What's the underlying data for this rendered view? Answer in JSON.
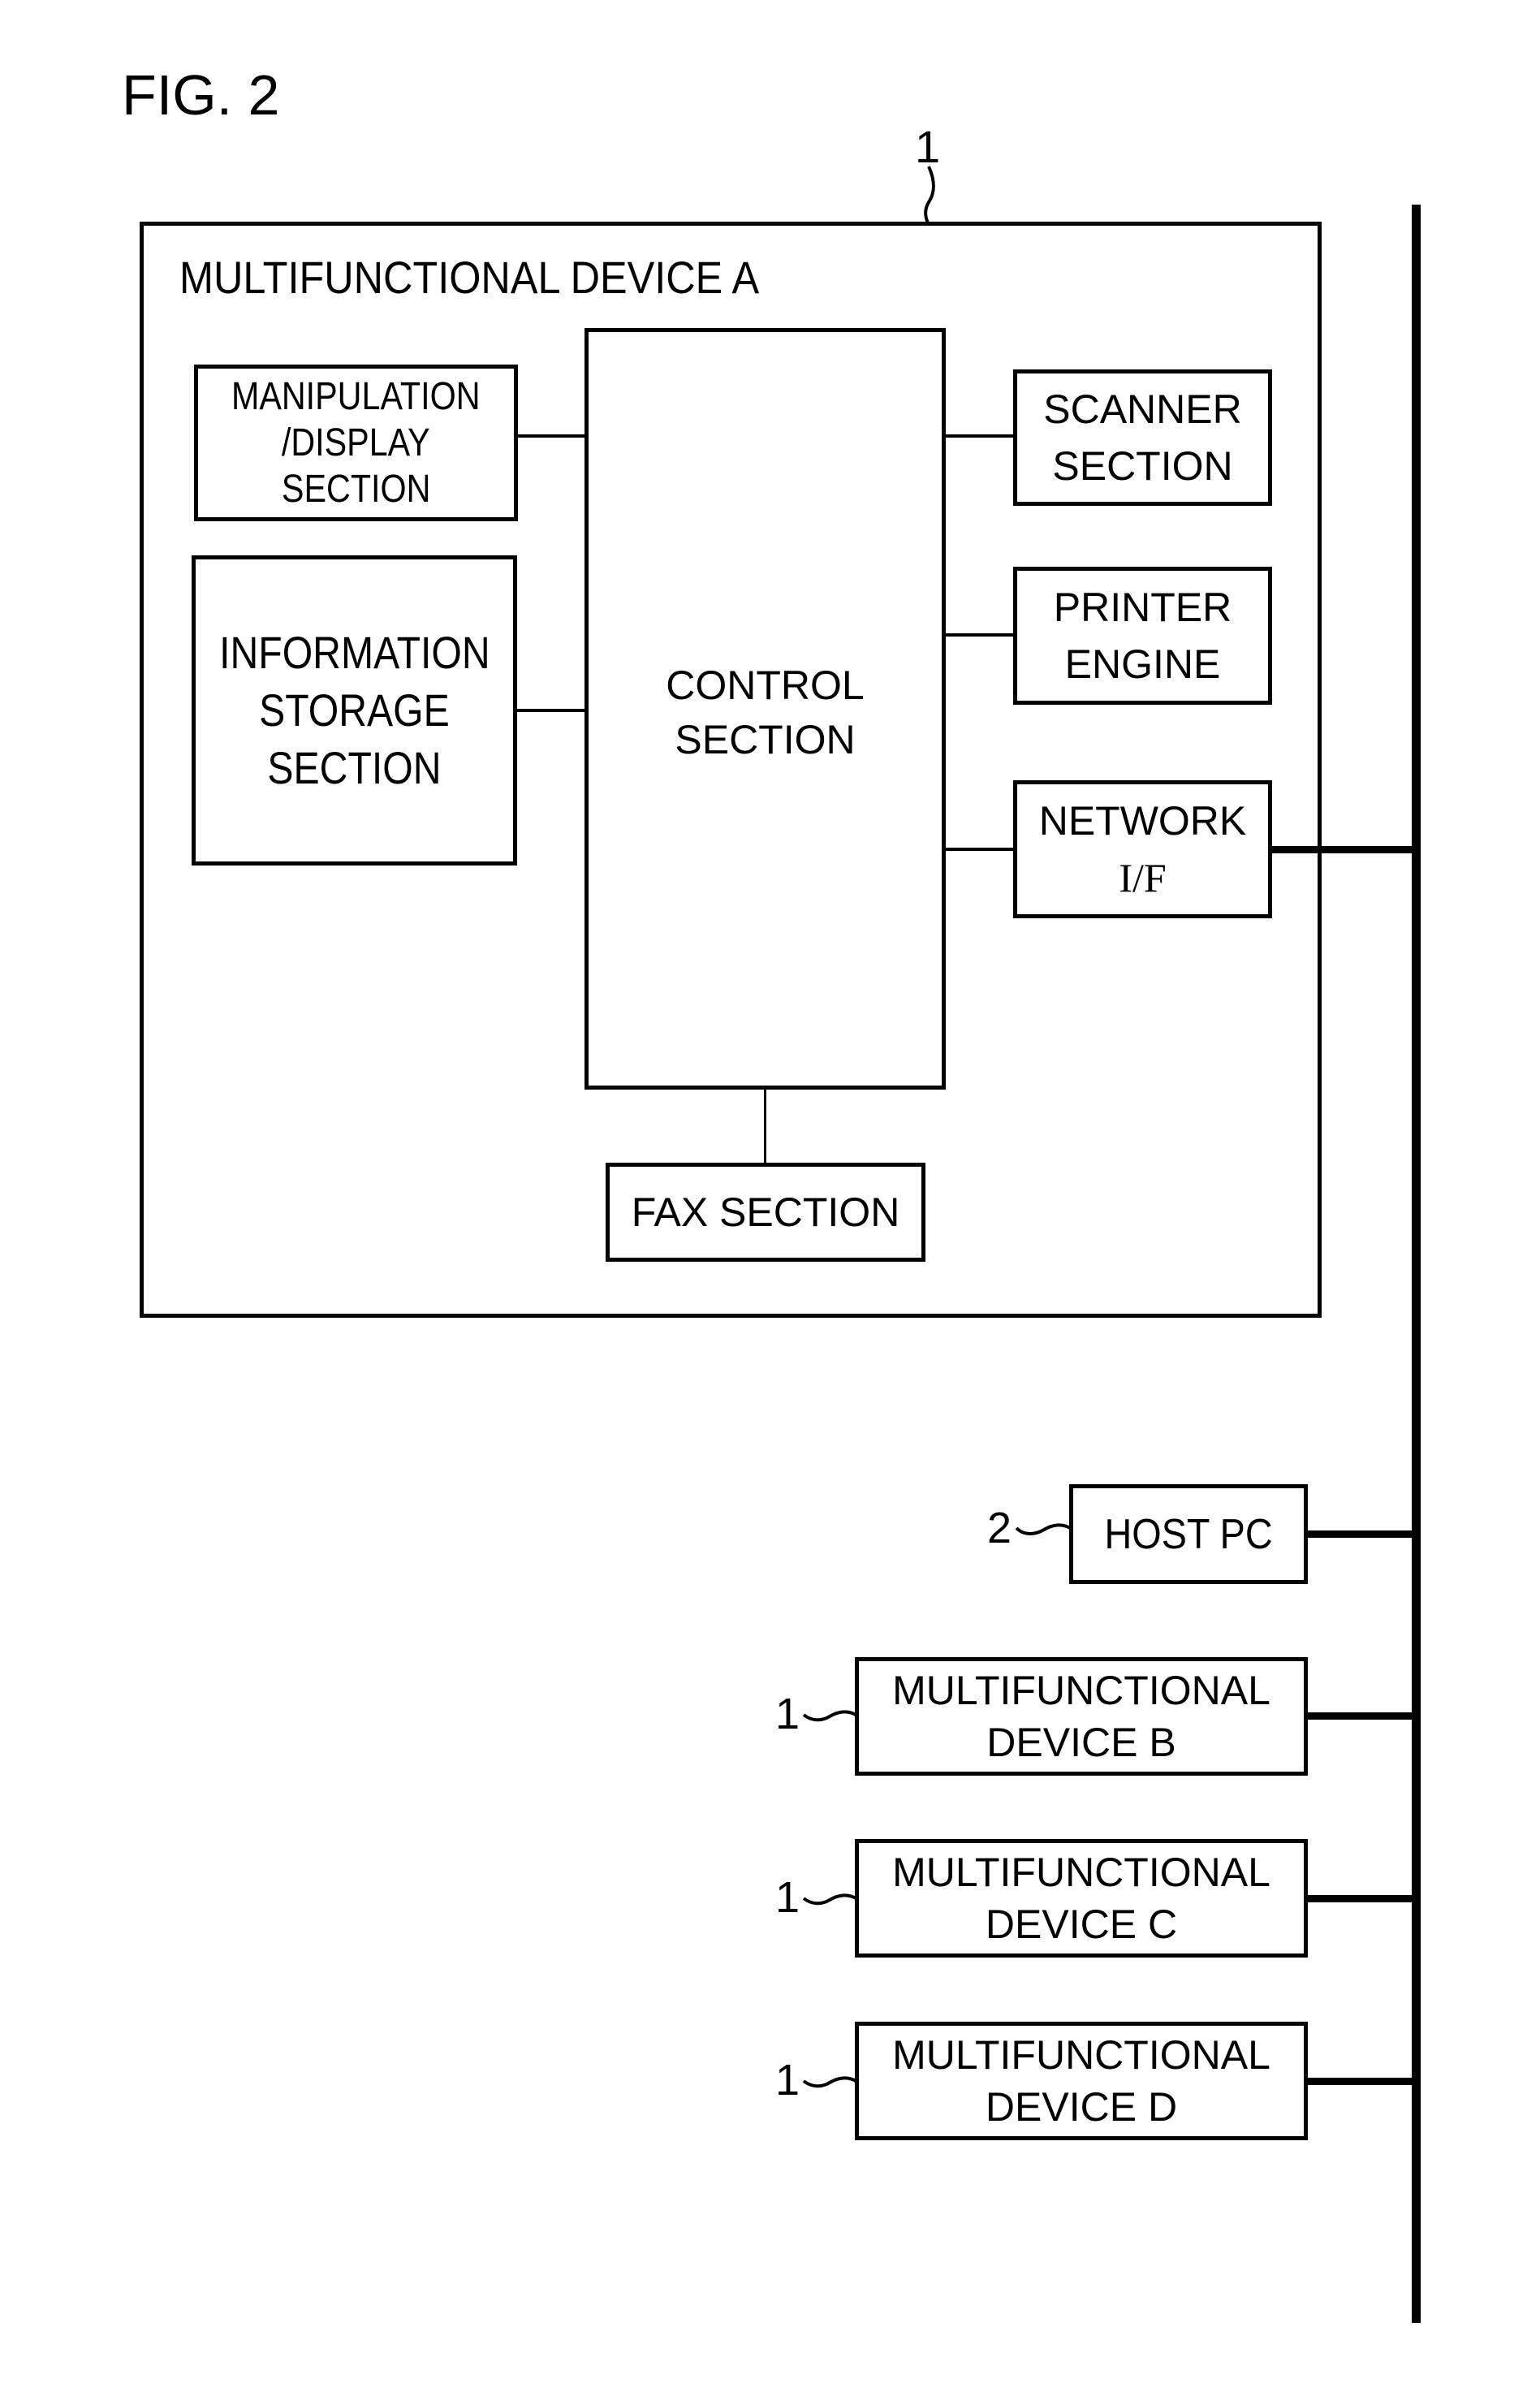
{
  "figure": {
    "title": "FIG. 2",
    "device_ref_label": "1"
  },
  "device_a": {
    "title": "MULTIFUNCTIONAL DEVICE A",
    "blocks": {
      "manipulation": [
        "MANIPULATION",
        "/DISPLAY",
        "SECTION"
      ],
      "information_storage": [
        "INFORMATION",
        "STORAGE",
        "SECTION"
      ],
      "control": [
        "CONTROL",
        "SECTION"
      ],
      "scanner": [
        "SCANNER",
        "SECTION"
      ],
      "printer": [
        "PRINTER",
        "ENGINE"
      ],
      "network": [
        "NETWORK",
        "I/F"
      ],
      "fax": [
        "FAX SECTION"
      ]
    }
  },
  "network_nodes": [
    {
      "ref": "2",
      "lines": [
        "HOST PC"
      ]
    },
    {
      "ref": "1",
      "lines": [
        "MULTIFUNCTIONAL",
        "DEVICE B"
      ]
    },
    {
      "ref": "1",
      "lines": [
        "MULTIFUNCTIONAL",
        "DEVICE C"
      ]
    },
    {
      "ref": "1",
      "lines": [
        "MULTIFUNCTIONAL",
        "DEVICE D"
      ]
    }
  ]
}
